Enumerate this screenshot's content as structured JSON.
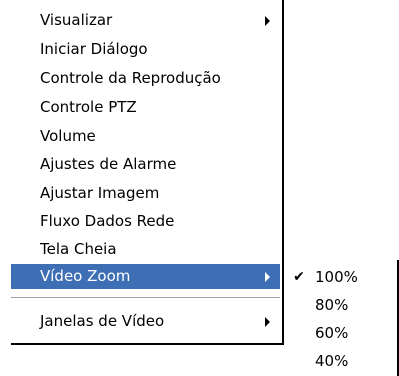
{
  "menu": {
    "items": [
      {
        "label": "Visualizar",
        "has_submenu": true
      },
      {
        "label": "Iniciar Diálogo"
      },
      {
        "label": "Controle da Reprodução"
      },
      {
        "label": "Controle PTZ"
      },
      {
        "label": "Volume"
      },
      {
        "label": "Ajustes de Alarme"
      },
      {
        "label": "Ajustar Imagem"
      },
      {
        "label": "Fluxo Dados Rede"
      },
      {
        "label": "Tela Cheia"
      },
      {
        "label": "Vídeo Zoom",
        "has_submenu": true,
        "highlighted": true
      },
      {
        "label": "Janelas de Vídeo",
        "has_submenu": true
      }
    ]
  },
  "submenu": {
    "items": [
      {
        "label": "100%",
        "checked": true
      },
      {
        "label": "80%"
      },
      {
        "label": "60%"
      },
      {
        "label": "40%"
      }
    ],
    "check_glyph": "✔"
  },
  "colors": {
    "highlight": "#3e6fb5",
    "highlight_text": "#ffffff"
  },
  "icons": {
    "submenu_arrow": "triangle-right-icon",
    "check": "checkmark-icon"
  }
}
